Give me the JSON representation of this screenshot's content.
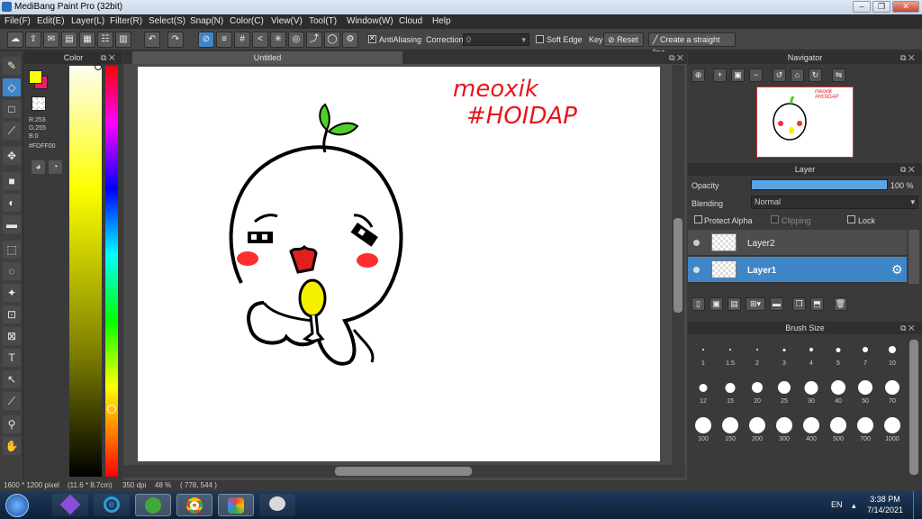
{
  "window": {
    "title": "MediBang Paint Pro (32bit)"
  },
  "menu": [
    "File(F)",
    "Edit(E)",
    "Layer(L)",
    "Filter(R)",
    "Select(S)",
    "Snap(N)",
    "Color(C)",
    "View(V)",
    "Tool(T)",
    "Window(W)",
    "Cloud",
    "Help"
  ],
  "toolbar": {
    "antialiasing_label": "AntiAliasing",
    "correction_label": "Correction",
    "correction_value": "0",
    "soft_edge_label": "Soft Edge",
    "key_label": "Key",
    "reset_label": "Reset",
    "straight_line_label": "Create a straight line"
  },
  "color_panel": {
    "title": "Color",
    "r": "R:253",
    "g": "G:255",
    "b": "B:0",
    "hex": "#FDFF00",
    "primary": "#fdff00",
    "secondary": "#e8216f"
  },
  "canvas": {
    "tab_title": "Untitled",
    "handwriting_line1": "meoxik",
    "handwriting_line2": "#HOIDAP"
  },
  "navigator": {
    "title": "Navigator"
  },
  "layer_panel": {
    "title": "Layer",
    "opacity_label": "Opacity",
    "opacity_value": "100 %",
    "opacity_fraction": 1.0,
    "blending_label": "Blending",
    "blending_value": "Normal",
    "protect_alpha": "Protect Alpha",
    "clipping": "Clipping",
    "lock": "Lock",
    "layers": [
      {
        "name": "Layer2",
        "selected": false
      },
      {
        "name": "Layer1",
        "selected": true
      }
    ]
  },
  "brush_panel": {
    "title": "Brush Size",
    "sizes": [
      "1",
      "1.5",
      "2",
      "3",
      "4",
      "5",
      "7",
      "10",
      "12",
      "15",
      "20",
      "25",
      "30",
      "40",
      "50",
      "70",
      "100",
      "150",
      "200",
      "300",
      "400",
      "500",
      "700",
      "1000"
    ]
  },
  "status": {
    "dimensions": "1600 * 1200 pixel",
    "physical": "(11.6 * 8.7cm)",
    "dpi": "350 dpi",
    "zoom": "48 %",
    "cursor": "( 778, 544 )"
  },
  "taskbar": {
    "language": "EN",
    "time": "3:38 PM",
    "date": "7/14/2021"
  }
}
